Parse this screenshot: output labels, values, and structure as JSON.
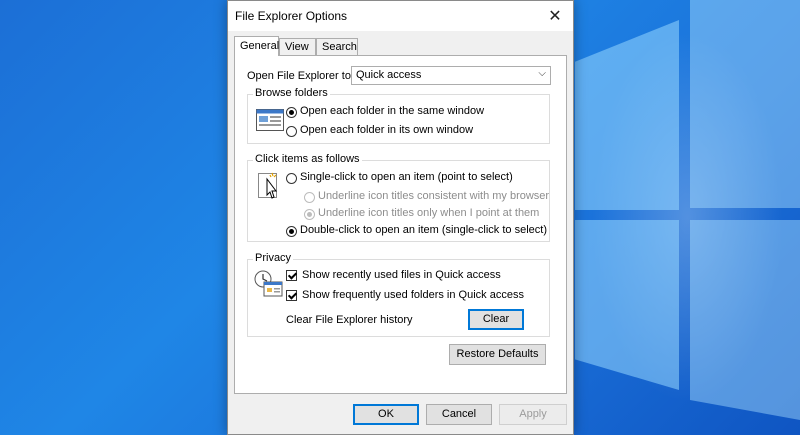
{
  "dialog": {
    "title": "File Explorer Options",
    "close_icon": "close-icon"
  },
  "tabs": [
    {
      "label": "General",
      "active": true
    },
    {
      "label": "View",
      "active": false
    },
    {
      "label": "Search",
      "active": false
    }
  ],
  "general": {
    "open_to_label": "Open File Explorer to:",
    "open_to_value": "Quick access",
    "browse_folders": {
      "title": "Browse folders",
      "icon": "folder-window-icon",
      "options": [
        {
          "label": "Open each folder in the same window",
          "selected": true
        },
        {
          "label": "Open each folder in its own window",
          "selected": false
        }
      ]
    },
    "click_items": {
      "title": "Click items as follows",
      "icon": "pointer-click-icon",
      "single_click": {
        "label": "Single-click to open an item (point to select)",
        "selected": false
      },
      "underline_browser": {
        "label": "Underline icon titles consistent with my browser",
        "selected": false,
        "enabled": false
      },
      "underline_point": {
        "label": "Underline icon titles only when I point at them",
        "selected": true,
        "enabled": false
      },
      "double_click": {
        "label": "Double-click to open an item (single-click to select)",
        "selected": true
      }
    },
    "privacy": {
      "title": "Privacy",
      "icon": "history-clock-icon",
      "recent_files": {
        "label": "Show recently used files in Quick access",
        "checked": true
      },
      "frequent_folders": {
        "label": "Show frequently used folders in Quick access",
        "checked": true
      },
      "clear_history_label": "Clear File Explorer history",
      "clear_button": "Clear"
    },
    "restore_defaults": "Restore Defaults"
  },
  "footer": {
    "ok": "OK",
    "cancel": "Cancel",
    "apply": "Apply"
  },
  "colors": {
    "accent": "#0078d7",
    "desktop": "#1a78dc"
  }
}
